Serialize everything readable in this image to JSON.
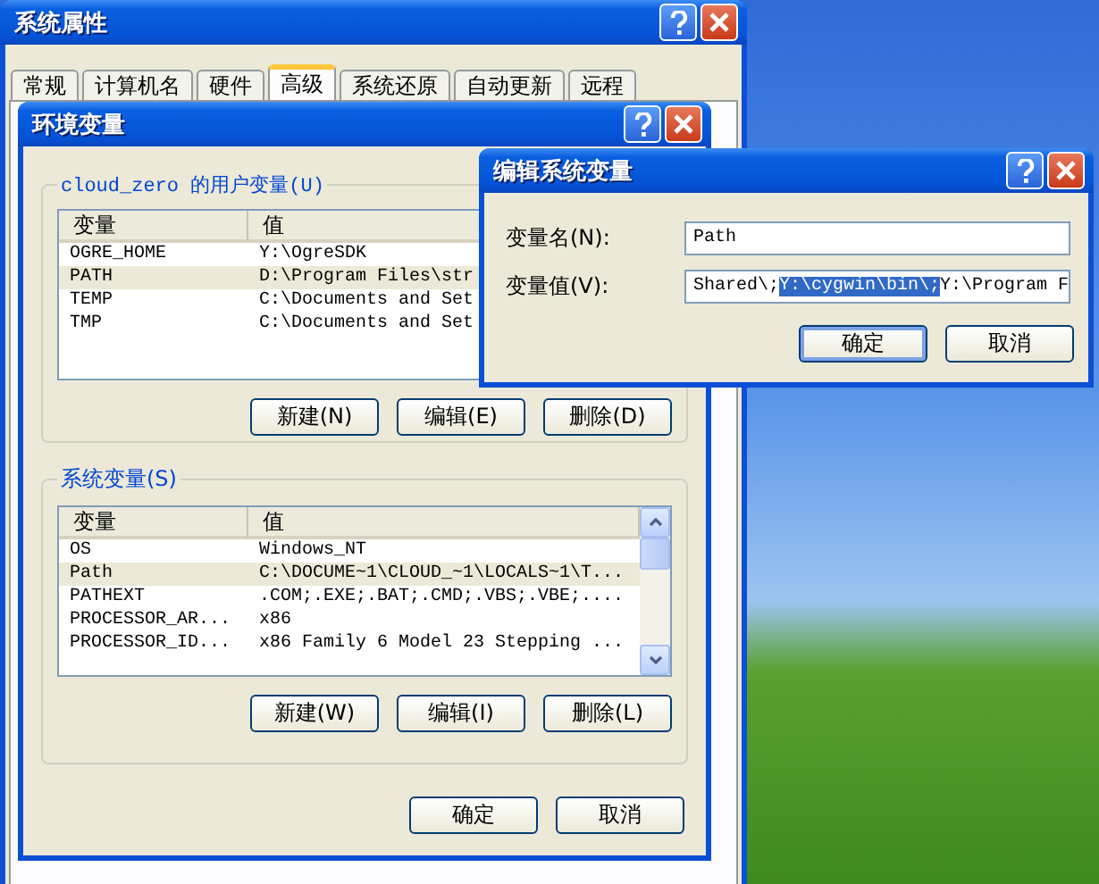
{
  "system_properties": {
    "title": "系统属性",
    "tabs": [
      {
        "label": "常规",
        "selected": false
      },
      {
        "label": "计算机名",
        "selected": false
      },
      {
        "label": "硬件",
        "selected": false
      },
      {
        "label": "高级",
        "selected": true
      },
      {
        "label": "系统还原",
        "selected": false
      },
      {
        "label": "自动更新",
        "selected": false
      },
      {
        "label": "远程",
        "selected": false
      }
    ]
  },
  "environment_variables": {
    "title": "环境变量",
    "user_group": {
      "title": "cloud_zero 的用户变量(U)",
      "columns": [
        "变量",
        "值"
      ],
      "rows": [
        {
          "name": "OGRE_HOME",
          "value": "Y:\\OgreSDK",
          "selected": false
        },
        {
          "name": "PATH",
          "value": "D:\\Program Files\\str",
          "selected": true
        },
        {
          "name": "TEMP",
          "value": "C:\\Documents and Set",
          "selected": false
        },
        {
          "name": "TMP",
          "value": "C:\\Documents and Set",
          "selected": false
        }
      ],
      "buttons": [
        "新建(N)",
        "编辑(E)",
        "删除(D)"
      ]
    },
    "system_group": {
      "title": "系统变量(S)",
      "columns": [
        "变量",
        "值"
      ],
      "rows": [
        {
          "name": "OS",
          "value": "Windows_NT",
          "selected": false
        },
        {
          "name": "Path",
          "value": "C:\\DOCUME~1\\CLOUD_~1\\LOCALS~1\\T...",
          "selected": true
        },
        {
          "name": "PATHEXT",
          "value": ".COM;.EXE;.BAT;.CMD;.VBS;.VBE;....",
          "selected": false
        },
        {
          "name": "PROCESSOR_AR...",
          "value": "x86",
          "selected": false
        },
        {
          "name": "PROCESSOR_ID...",
          "value": "x86 Family 6 Model 23 Stepping ...",
          "selected": false
        }
      ],
      "buttons": [
        "新建(W)",
        "编辑(I)",
        "删除(L)"
      ]
    },
    "buttons": [
      "确定",
      "取消"
    ]
  },
  "edit_dialog": {
    "title": "编辑系统变量",
    "fields": [
      {
        "label": "变量名(N):",
        "segments": [
          {
            "text": "Path",
            "selected": false
          }
        ]
      },
      {
        "label": "变量值(V):",
        "segments": [
          {
            "text": "Shared\\;",
            "selected": false
          },
          {
            "text": "Y:\\cygwin\\bin\\;",
            "selected": true
          },
          {
            "text": "Y:\\Program F",
            "selected": false
          }
        ]
      }
    ],
    "buttons": [
      {
        "label": "确定",
        "default": true
      },
      {
        "label": "取消",
        "default": false
      }
    ]
  }
}
